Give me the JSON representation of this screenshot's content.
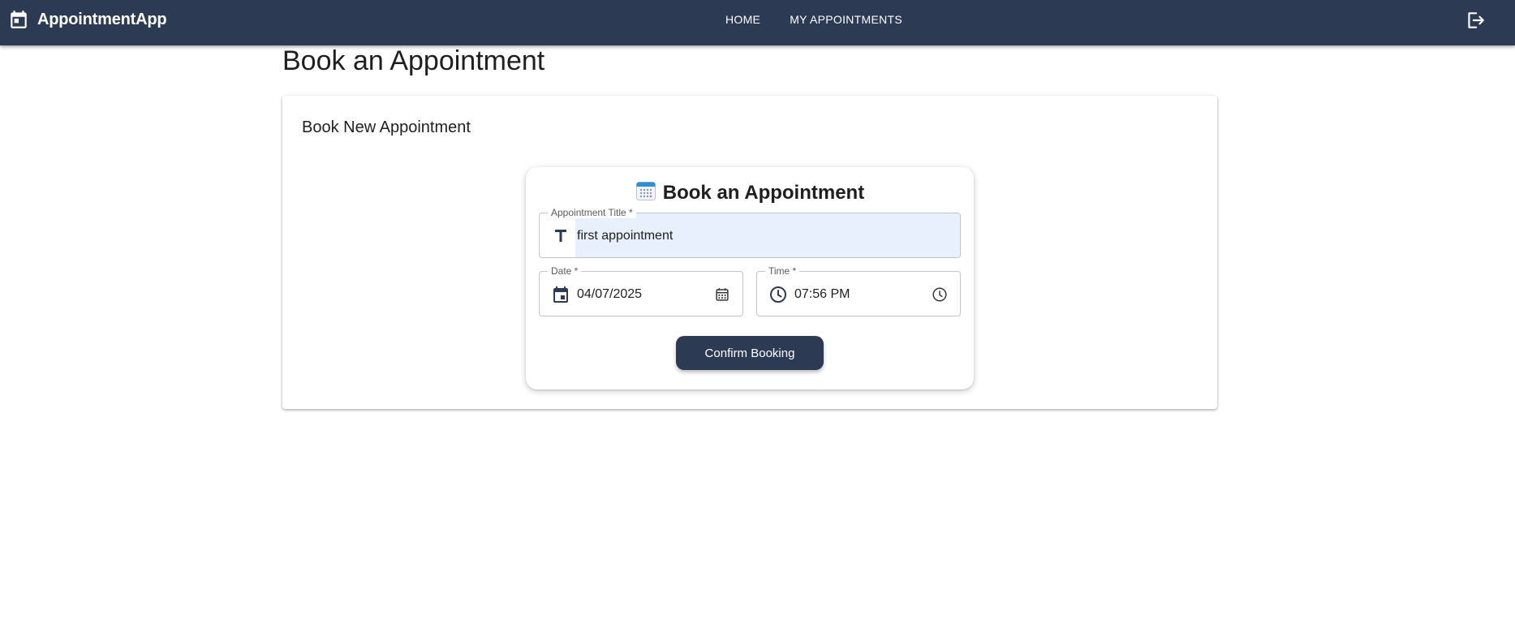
{
  "app": {
    "brand": "AppointmentApp",
    "brand_icon": "calendar-icon",
    "logout_icon": "logout-icon"
  },
  "nav": {
    "items": [
      {
        "label": "HOME"
      },
      {
        "label": "MY APPOINTMENTS"
      }
    ]
  },
  "page": {
    "title": "Book an Appointment"
  },
  "card": {
    "title": "Book New Appointment"
  },
  "form": {
    "heading": "Book an Appointment",
    "heading_icon": "calendar-emoji-icon",
    "title_field": {
      "label": "Appointment Title *",
      "value": "first appointment",
      "icon": "text-title-icon"
    },
    "date_field": {
      "label": "Date *",
      "value": "04/07/2025",
      "icon": "event-icon",
      "picker_icon": "calendar-picker-icon"
    },
    "time_field": {
      "label": "Time *",
      "value": "07:56 PM",
      "icon": "clock-icon",
      "picker_icon": "clock-picker-icon"
    },
    "submit_label": "Confirm Booking"
  },
  "colors": {
    "primary": "#2d3a54",
    "autofill": "#e8f0fe"
  }
}
